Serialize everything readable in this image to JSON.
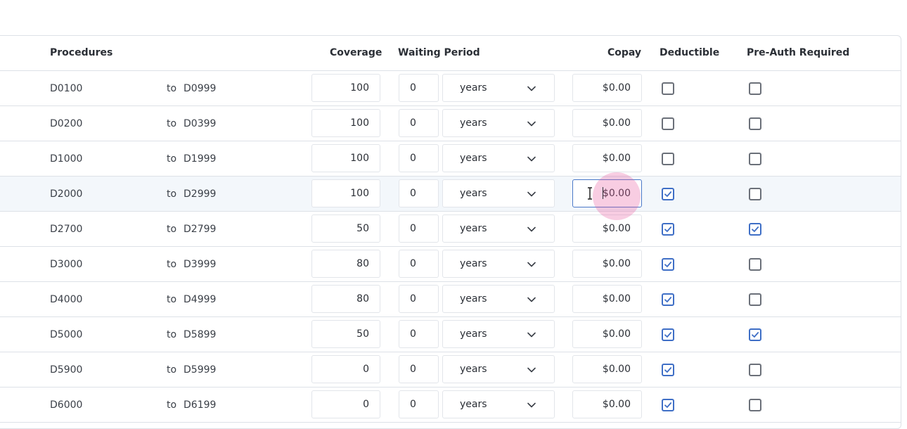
{
  "headers": {
    "procedures": "Procedures",
    "coverage": "Coverage",
    "waiting_period": "Waiting Period",
    "copay": "Copay",
    "deductible": "Deductible",
    "preauth": "Pre-Auth Required"
  },
  "to_label": "to",
  "rows": [
    {
      "from": "D0100",
      "to": "D0999",
      "coverage": "100",
      "wait": "0",
      "unit": "years",
      "copay": "$0.00",
      "deductible": false,
      "preauth": false
    },
    {
      "from": "D0200",
      "to": "D0399",
      "coverage": "100",
      "wait": "0",
      "unit": "years",
      "copay": "$0.00",
      "deductible": false,
      "preauth": false
    },
    {
      "from": "D1000",
      "to": "D1999",
      "coverage": "100",
      "wait": "0",
      "unit": "years",
      "copay": "$0.00",
      "deductible": false,
      "preauth": false
    },
    {
      "from": "D2000",
      "to": "D2999",
      "coverage": "100",
      "wait": "0",
      "unit": "years",
      "copay": "$0.00",
      "deductible": true,
      "preauth": false,
      "active": true
    },
    {
      "from": "D2700",
      "to": "D2799",
      "coverage": "50",
      "wait": "0",
      "unit": "years",
      "copay": "$0.00",
      "deductible": true,
      "preauth": true
    },
    {
      "from": "D3000",
      "to": "D3999",
      "coverage": "80",
      "wait": "0",
      "unit": "years",
      "copay": "$0.00",
      "deductible": true,
      "preauth": false
    },
    {
      "from": "D4000",
      "to": "D4999",
      "coverage": "80",
      "wait": "0",
      "unit": "years",
      "copay": "$0.00",
      "deductible": true,
      "preauth": false
    },
    {
      "from": "D5000",
      "to": "D5899",
      "coverage": "50",
      "wait": "0",
      "unit": "years",
      "copay": "$0.00",
      "deductible": true,
      "preauth": true
    },
    {
      "from": "D5900",
      "to": "D5999",
      "coverage": "0",
      "wait": "0",
      "unit": "years",
      "copay": "$0.00",
      "deductible": true,
      "preauth": false
    },
    {
      "from": "D6000",
      "to": "D6199",
      "coverage": "0",
      "wait": "0",
      "unit": "years",
      "copay": "$0.00",
      "deductible": true,
      "preauth": false
    }
  ],
  "icons": {
    "dropdown": "chevron-down-icon",
    "checkbox": "checkbox-icon",
    "cursor": "text-cursor-icon"
  },
  "colors": {
    "checked": "#3f6fc6",
    "unchecked": "#6b7079",
    "active_row": "#f3f7fb",
    "focus_border": "#4a78c8",
    "cursor_highlight": "#e85aa0"
  }
}
